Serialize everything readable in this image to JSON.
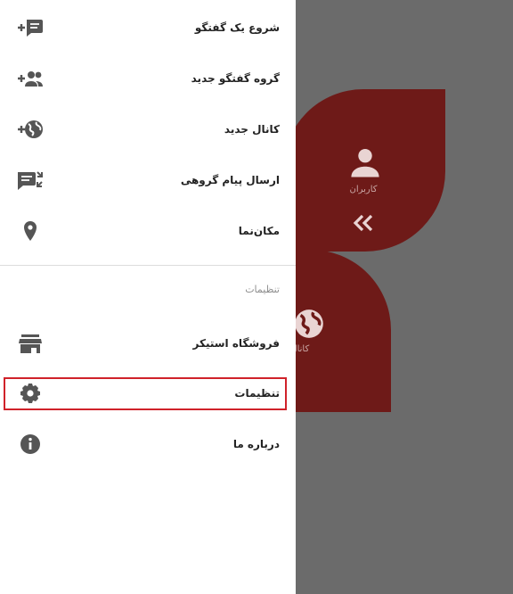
{
  "background": {
    "users_card": {
      "label": "کاربران",
      "icon": "user-icon"
    },
    "channels_card": {
      "label": "کانال‌ها",
      "icon": "globe-icon"
    },
    "collapse_icon": "double-chevron-left-icon",
    "accent_color": "#6e1a18"
  },
  "drawer": {
    "items": [
      {
        "label": "شروع یک گفتگو",
        "icon": "add-chat-icon"
      },
      {
        "label": "گروه گفتگو جدید",
        "icon": "add-group-icon"
      },
      {
        "label": "کانال جدید",
        "icon": "add-globe-icon"
      },
      {
        "label": "ارسال پیام گروهی",
        "icon": "broadcast-message-icon"
      },
      {
        "label": "مکان‌نما",
        "icon": "location-pin-icon"
      }
    ],
    "section_title": "تنظیمات",
    "settings_items": [
      {
        "label": "فروشگاه استیکر",
        "icon": "store-icon"
      },
      {
        "label": "تنظیمات",
        "icon": "gear-icon"
      },
      {
        "label": "درباره ما",
        "icon": "info-icon"
      }
    ],
    "highlight_color": "#d0222a"
  }
}
